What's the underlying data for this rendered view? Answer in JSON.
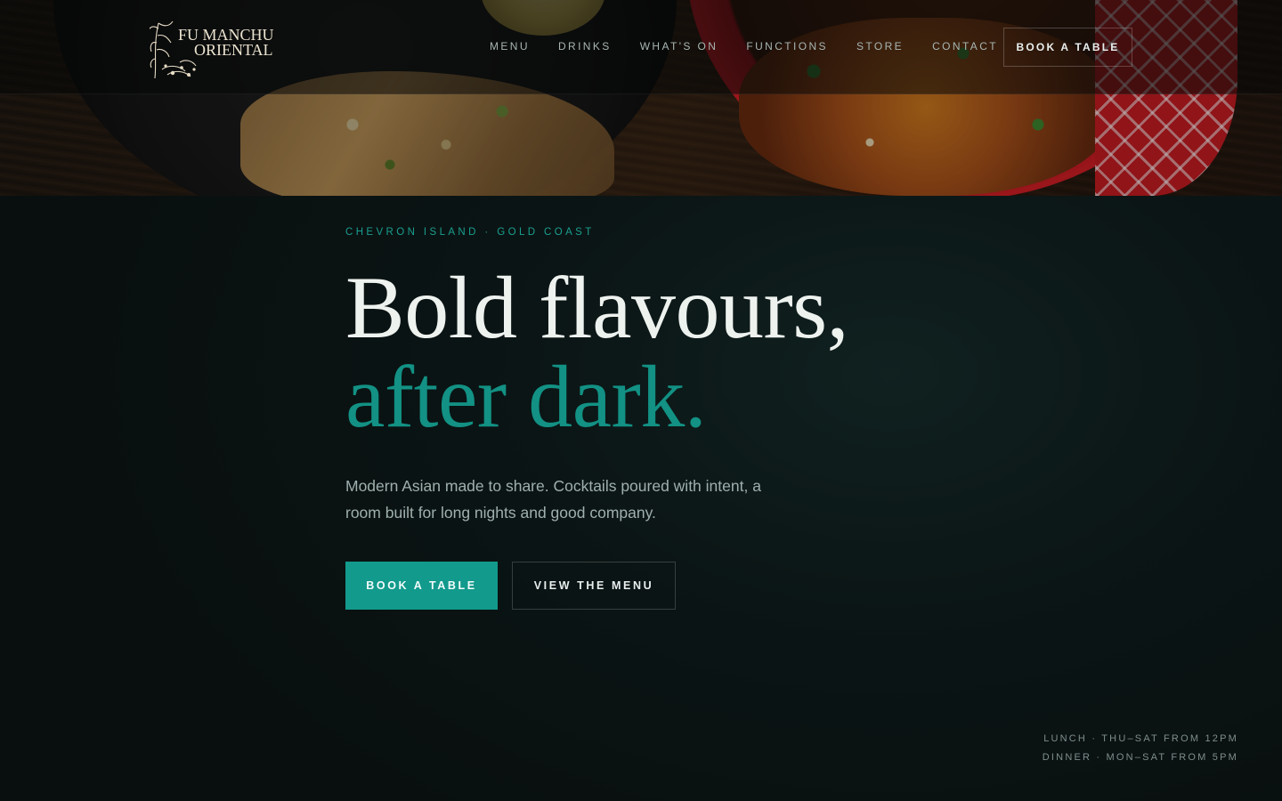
{
  "brand": {
    "name_line1": "FU MANCHU",
    "name_line2": "ORIENTAL"
  },
  "nav": {
    "links": [
      {
        "label": "MENU"
      },
      {
        "label": "DRINKS"
      },
      {
        "label": "WHAT'S ON"
      },
      {
        "label": "FUNCTIONS"
      },
      {
        "label": "STORE"
      },
      {
        "label": "CONTACT"
      }
    ],
    "cta_label": "BOOK A TABLE"
  },
  "hero": {
    "eyebrow": "CHEVRON ISLAND · GOLD COAST",
    "headline_line1": "Bold flavours,",
    "headline_line2": "after dark.",
    "lede": "Modern Asian made to share. Cocktails poured with intent, a room built for long nights and good company.",
    "primary_button": "BOOK A TABLE",
    "secondary_button": "VIEW THE MENU"
  },
  "hours": {
    "lunch": "LUNCH · THU–SAT FROM 12PM",
    "dinner": "DINNER · MON–SAT FROM 5PM"
  },
  "colors": {
    "accent": "#129a8c",
    "background": "#0a1111",
    "headline": "#eef2ef"
  }
}
